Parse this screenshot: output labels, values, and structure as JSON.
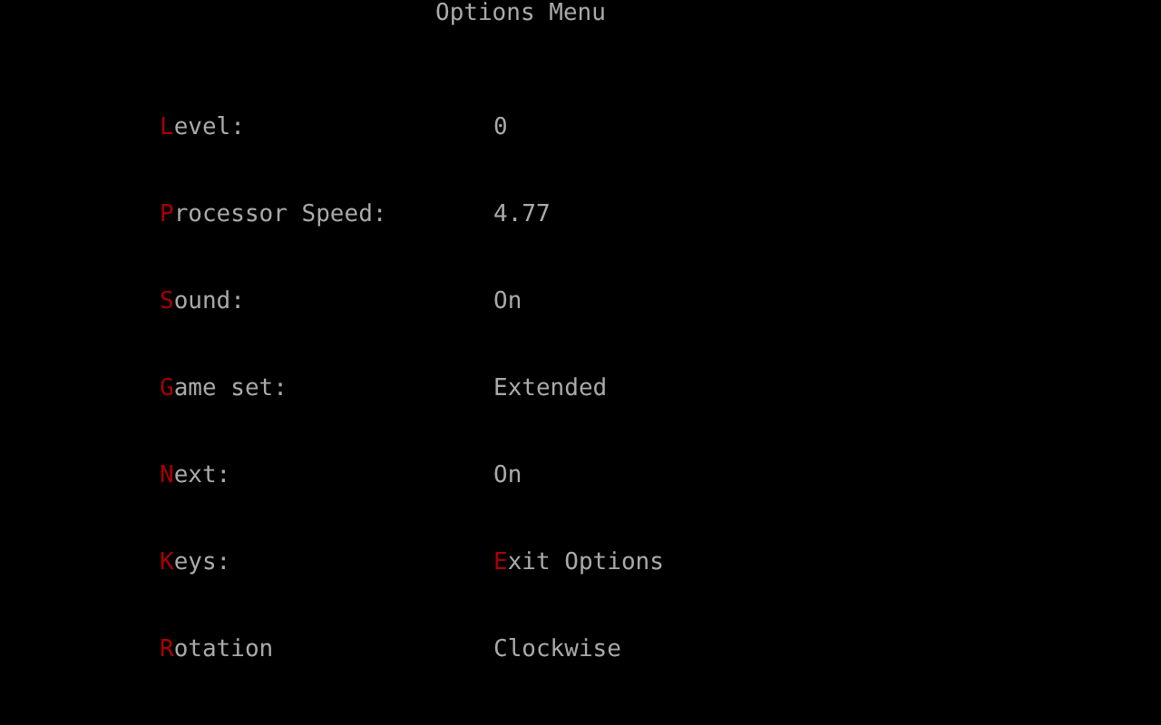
{
  "title": "Options Menu",
  "options": [
    {
      "hotkey": "L",
      "label": "evel:",
      "value": "0"
    },
    {
      "hotkey": "P",
      "label": "rocessor Speed:",
      "value": "4.77"
    },
    {
      "hotkey": "S",
      "label": "ound:",
      "value": "On"
    },
    {
      "hotkey": "G",
      "label": "ame set:",
      "value": "Extended"
    },
    {
      "hotkey": "N",
      "label": "ext:",
      "value": "On"
    },
    {
      "hotkey": "K",
      "label": "eys:",
      "value_hotkey": "E",
      "value": "xit Options"
    },
    {
      "hotkey": "R",
      "label": "otation",
      "value": "Clockwise"
    }
  ]
}
